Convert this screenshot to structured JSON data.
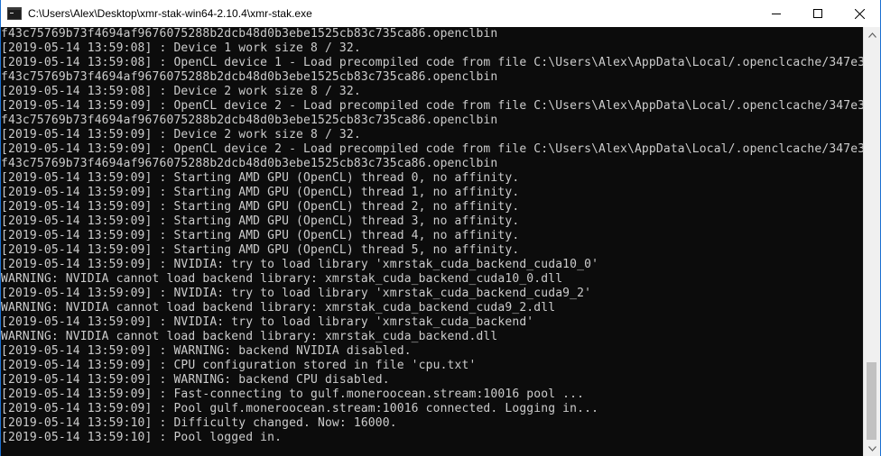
{
  "window": {
    "title": "C:\\Users\\Alex\\Desktop\\xmr-stak-win64-2.10.4\\xmr-stak.exe",
    "icon": "console-app-icon",
    "controls": [
      "minimize-icon",
      "maximize-icon",
      "close-icon"
    ]
  },
  "console": {
    "background": "#0c0c0c",
    "foreground": "#cccccc",
    "lines": [
      "f43c75769b73f4694af9676075288b2dcb48d0b3ebe1525cb83c735ca86.openclbin",
      "[2019-05-14 13:59:08] : Device 1 work size 8 / 32.",
      "[2019-05-14 13:59:08] : OpenCL device 1 - Load precompiled code from file C:\\Users\\Alex\\AppData\\Local/.openclcache/347e3",
      "f43c75769b73f4694af9676075288b2dcb48d0b3ebe1525cb83c735ca86.openclbin",
      "[2019-05-14 13:59:08] : Device 2 work size 8 / 32.",
      "[2019-05-14 13:59:09] : OpenCL device 2 - Load precompiled code from file C:\\Users\\Alex\\AppData\\Local/.openclcache/347e3",
      "f43c75769b73f4694af9676075288b2dcb48d0b3ebe1525cb83c735ca86.openclbin",
      "[2019-05-14 13:59:09] : Device 2 work size 8 / 32.",
      "[2019-05-14 13:59:09] : OpenCL device 2 - Load precompiled code from file C:\\Users\\Alex\\AppData\\Local/.openclcache/347e3",
      "f43c75769b73f4694af9676075288b2dcb48d0b3ebe1525cb83c735ca86.openclbin",
      "[2019-05-14 13:59:09] : Starting AMD GPU (OpenCL) thread 0, no affinity.",
      "[2019-05-14 13:59:09] : Starting AMD GPU (OpenCL) thread 1, no affinity.",
      "[2019-05-14 13:59:09] : Starting AMD GPU (OpenCL) thread 2, no affinity.",
      "[2019-05-14 13:59:09] : Starting AMD GPU (OpenCL) thread 3, no affinity.",
      "[2019-05-14 13:59:09] : Starting AMD GPU (OpenCL) thread 4, no affinity.",
      "[2019-05-14 13:59:09] : Starting AMD GPU (OpenCL) thread 5, no affinity.",
      "[2019-05-14 13:59:09] : NVIDIA: try to load library 'xmrstak_cuda_backend_cuda10_0'",
      "WARNING: NVIDIA cannot load backend library: xmrstak_cuda_backend_cuda10_0.dll",
      "[2019-05-14 13:59:09] : NVIDIA: try to load library 'xmrstak_cuda_backend_cuda9_2'",
      "WARNING: NVIDIA cannot load backend library: xmrstak_cuda_backend_cuda9_2.dll",
      "[2019-05-14 13:59:09] : NVIDIA: try to load library 'xmrstak_cuda_backend'",
      "WARNING: NVIDIA cannot load backend library: xmrstak_cuda_backend.dll",
      "[2019-05-14 13:59:09] : WARNING: backend NVIDIA disabled.",
      "[2019-05-14 13:59:09] : CPU configuration stored in file 'cpu.txt'",
      "[2019-05-14 13:59:09] : WARNING: backend CPU disabled.",
      "[2019-05-14 13:59:09] : Fast-connecting to gulf.moneroocean.stream:10016 pool ...",
      "[2019-05-14 13:59:09] : Pool gulf.moneroocean.stream:10016 connected. Logging in...",
      "[2019-05-14 13:59:10] : Difficulty changed. Now: 16000.",
      "[2019-05-14 13:59:10] : Pool logged in.",
      ""
    ]
  },
  "scrollbar": {
    "icons": [
      "scroll-up-arrow-icon",
      "scroll-down-arrow-icon"
    ]
  }
}
